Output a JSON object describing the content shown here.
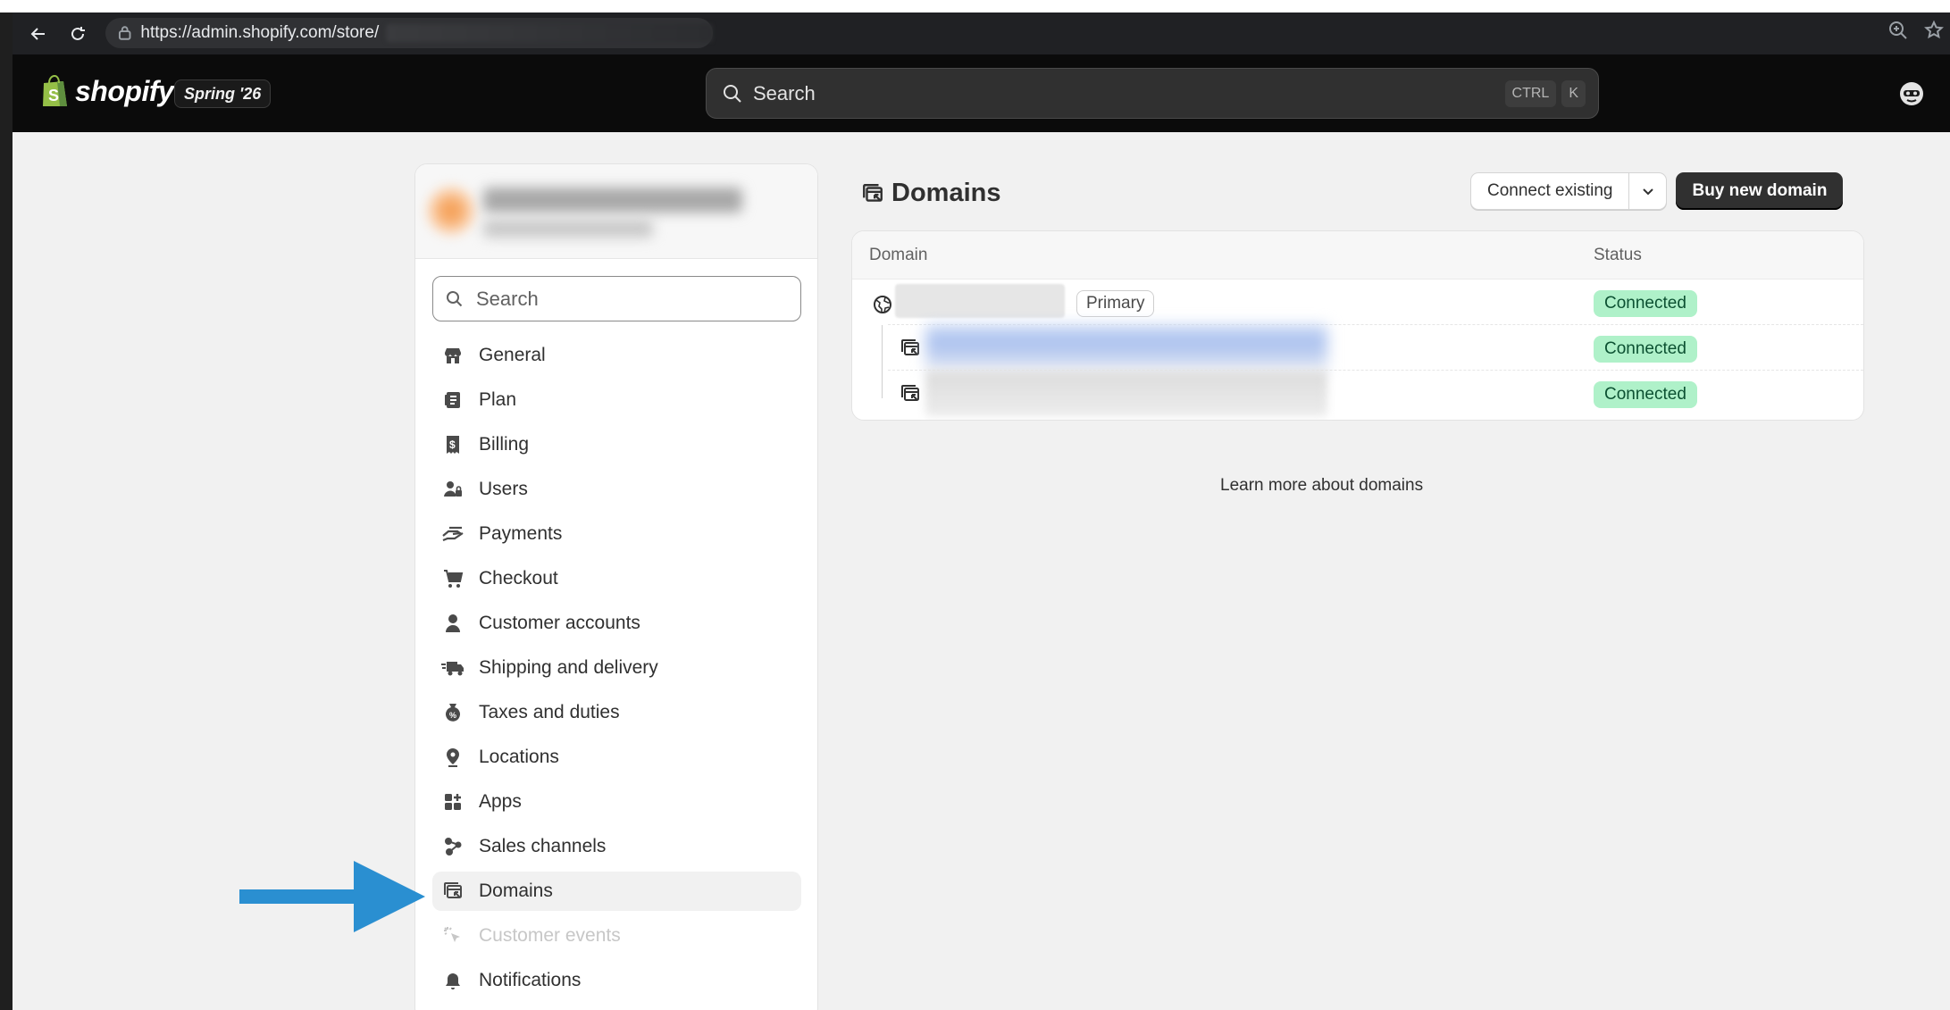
{
  "browser": {
    "url": "https://admin.shopify.com/store/"
  },
  "topbar": {
    "logo_text": "shopify",
    "release_badge": "Spring '26",
    "search_placeholder": "Search",
    "shortcut_keys": [
      "CTRL",
      "K"
    ]
  },
  "sidebar": {
    "search_placeholder": "Search",
    "items": [
      {
        "label": "General",
        "icon": "store-icon"
      },
      {
        "label": "Plan",
        "icon": "plan-icon"
      },
      {
        "label": "Billing",
        "icon": "billing-icon"
      },
      {
        "label": "Users",
        "icon": "users-icon"
      },
      {
        "label": "Payments",
        "icon": "payments-icon"
      },
      {
        "label": "Checkout",
        "icon": "cart-icon"
      },
      {
        "label": "Customer accounts",
        "icon": "person-icon"
      },
      {
        "label": "Shipping and delivery",
        "icon": "truck-icon"
      },
      {
        "label": "Taxes and duties",
        "icon": "tax-icon"
      },
      {
        "label": "Locations",
        "icon": "location-icon"
      },
      {
        "label": "Apps",
        "icon": "apps-icon"
      },
      {
        "label": "Sales channels",
        "icon": "sales-channels-icon"
      },
      {
        "label": "Domains",
        "icon": "domains-icon",
        "active": true
      },
      {
        "label": "Customer events",
        "icon": "cursor-icon",
        "disabled": true
      },
      {
        "label": "Notifications",
        "icon": "bell-icon"
      }
    ]
  },
  "page": {
    "title": "Domains",
    "connect_existing": "Connect existing",
    "buy_new_domain": "Buy new domain",
    "learn_more": "Learn more about domains"
  },
  "table": {
    "headers": {
      "domain": "Domain",
      "status": "Status"
    },
    "rows": [
      {
        "badge": "Primary",
        "status": "Connected"
      },
      {
        "status": "Connected"
      },
      {
        "status": "Connected"
      }
    ]
  },
  "colors": {
    "connected_bg": "#aff1c9",
    "connected_text": "#0c5132",
    "arrow": "#2a8fd1",
    "topbar": "#0b0b0b"
  }
}
